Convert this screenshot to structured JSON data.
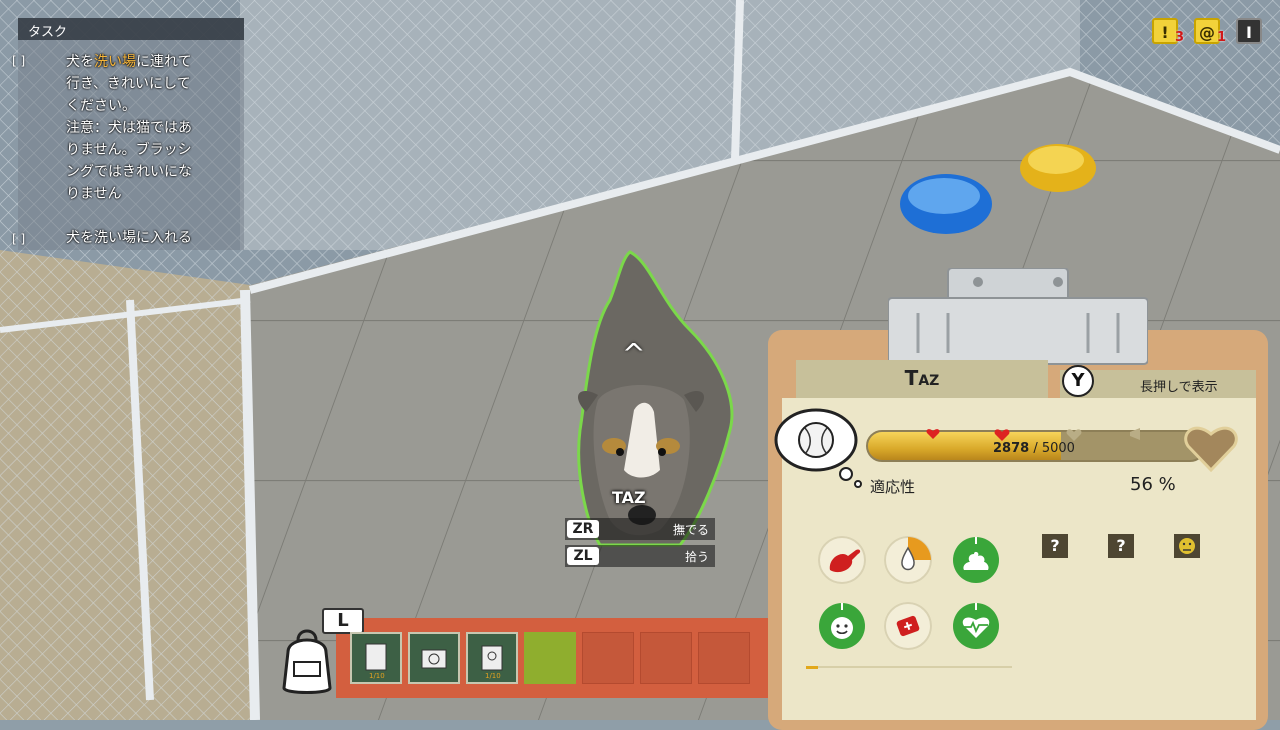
{
  "tasks": {
    "header": "タスク",
    "task1": {
      "checkbox": "[ ]",
      "lines": [
        "犬を",
        "洗い場",
        "に連れて",
        "行き、きれいにして",
        "ください。",
        "注意：犬は猫ではあ",
        "りません。ブラッシ",
        "ングではきれいにな",
        "りません"
      ]
    },
    "task2": {
      "checkbox": "[ ]",
      "text": "犬を洗い場に入れる"
    }
  },
  "top_icons": {
    "alert_symbol": "!",
    "alert_count": "3",
    "mail_symbol": "@",
    "mail_count": "1",
    "menu_symbol": "I"
  },
  "dog": {
    "name": "TAZ",
    "up_arrow": "^",
    "actions": [
      {
        "key": "ZR",
        "label": "撫でる"
      },
      {
        "key": "ZL",
        "label": "拾う"
      }
    ]
  },
  "inventory": {
    "key": "L",
    "slots": [
      {
        "state": "item",
        "icon": "bag-icon"
      },
      {
        "state": "item",
        "icon": "camera-icon"
      },
      {
        "state": "item",
        "icon": "toy-icon"
      },
      {
        "state": "selected-empty"
      },
      {
        "state": "empty"
      },
      {
        "state": "empty"
      },
      {
        "state": "empty"
      }
    ]
  },
  "clipboard": {
    "name": "Taz",
    "y_button": "Y",
    "hold_hint": "長押しで表示",
    "bond": {
      "current": "2878",
      "separator": " / ",
      "max": "5000",
      "progress": 0.5756
    },
    "adaptability_label": "適応性",
    "adaptability_value": "56 %",
    "stats": [
      "food-icon",
      "water-icon",
      "poop-icon",
      "happy-icon",
      "health-kit-icon",
      "health-heart-icon"
    ],
    "unknown_1": "?",
    "unknown_2": "?",
    "colors": {
      "accent_green": "#3aa63a",
      "stat_bg": "#f3eed8",
      "bar_gold": "#e0b12f"
    }
  }
}
